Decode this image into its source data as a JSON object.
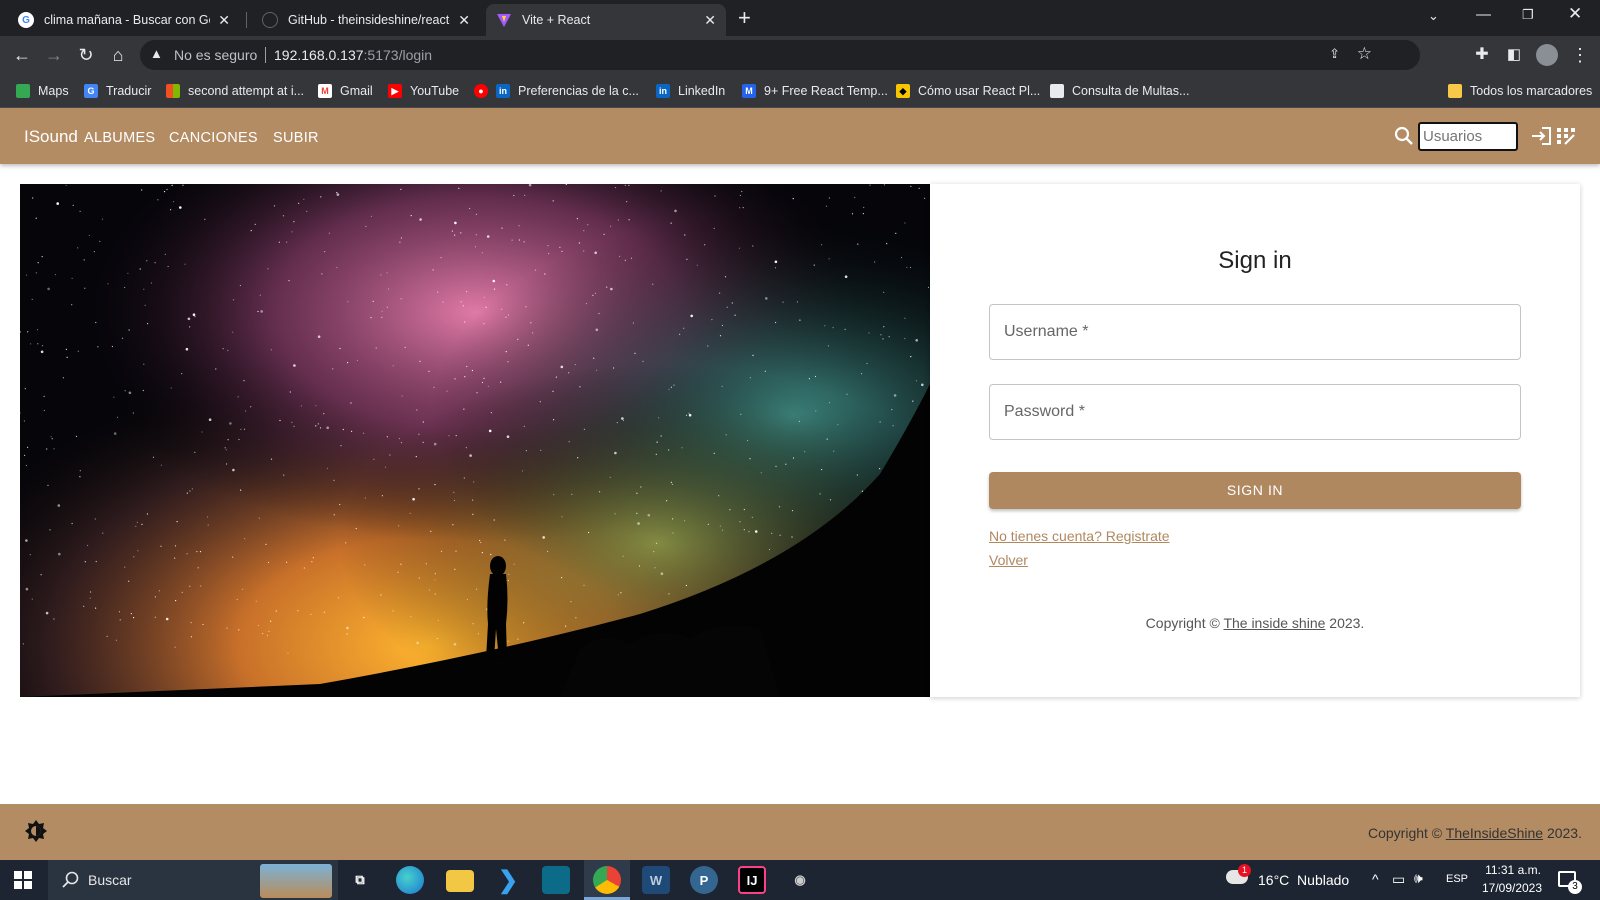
{
  "browser": {
    "tabs": [
      {
        "label": "clima mañana - Buscar con Google",
        "active": false
      },
      {
        "label": "GitHub - theinsideshine/react-ins",
        "active": false
      },
      {
        "label": "Vite + React",
        "active": true
      }
    ],
    "new_tab": "+",
    "security_label": "No es seguro",
    "url_host": "192.168.0.137",
    "url_rest": ":5173/login",
    "bookmarks": [
      {
        "label": "Maps",
        "icon": "maps-icon"
      },
      {
        "label": "Traducir",
        "icon": "translate-icon"
      },
      {
        "label": "second attempt at i...",
        "icon": "microsoft-icon"
      },
      {
        "label": "Gmail",
        "icon": "gmail-icon"
      },
      {
        "label": "YouTube",
        "icon": "youtube-icon"
      },
      {
        "label": "Preferencias de la c...",
        "icon": "linkedin-icon"
      },
      {
        "label": "LinkedIn",
        "icon": "linkedin-icon"
      },
      {
        "label": "9+ Free React Temp...",
        "icon": "react-template-icon"
      },
      {
        "label": "Cómo usar React Pl...",
        "icon": "cat-icon"
      },
      {
        "label": "Consulta de Multas...",
        "icon": "document-icon"
      }
    ],
    "all_bookmarks": "Todos los marcadores"
  },
  "app": {
    "brand": "ISound",
    "nav": [
      "ALBUMES",
      "CANCIONES",
      "SUBIR"
    ],
    "search_placeholder": "Usuarios",
    "accent": "#b48c64"
  },
  "login": {
    "title": "Sign in",
    "username_label": "Username *",
    "password_label": "Password *",
    "submit": "SIGN IN",
    "register_link": "No tienes cuenta? Registrate",
    "back_link": "Volver",
    "copyright_prefix": "Copyright © ",
    "copyright_link": "The inside shine",
    "copyright_suffix": " 2023."
  },
  "footer": {
    "copyright_prefix": "Copyright © ",
    "copyright_link": "TheInsideShine",
    "copyright_suffix": " 2023."
  },
  "taskbar": {
    "search": "Buscar",
    "weather": "16°C  Nublado",
    "weather_badge": "1",
    "lang": "ESP",
    "time": "11:31 a.m.",
    "date": "17/09/2023",
    "notifications": "3"
  }
}
